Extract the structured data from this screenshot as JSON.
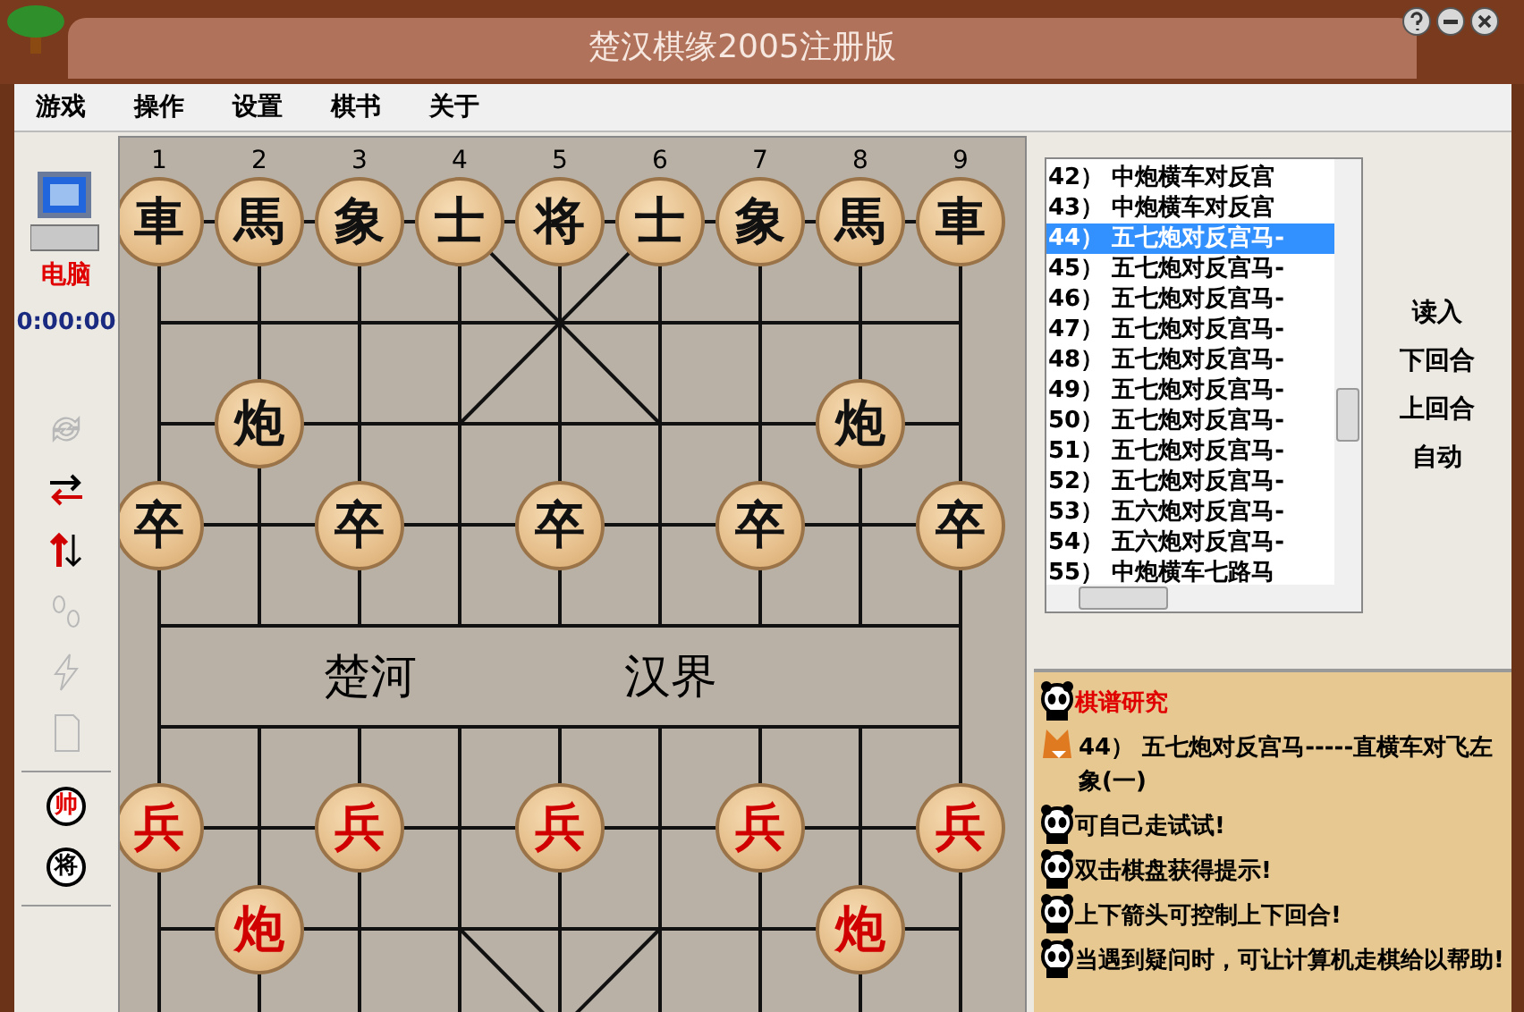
{
  "window": {
    "title": "楚汉棋缘2005注册版"
  },
  "menu": [
    {
      "label": "游戏"
    },
    {
      "label": "操作"
    },
    {
      "label": "设置"
    },
    {
      "label": "棋书"
    },
    {
      "label": "关于"
    }
  ],
  "player": {
    "name": "电脑",
    "time": "0:00:00"
  },
  "toolbar": [
    {
      "kind": "cycle",
      "disabled": true
    },
    {
      "kind": "swap",
      "disabled": false
    },
    {
      "kind": "updown",
      "disabled": false
    },
    {
      "kind": "steps",
      "disabled": true
    },
    {
      "kind": "bolt",
      "disabled": true
    },
    {
      "kind": "page",
      "disabled": true
    }
  ],
  "side_buttons": [
    {
      "label": "帅",
      "color": "#e00000"
    },
    {
      "label": "将",
      "color": "#000000"
    }
  ],
  "board": {
    "file_numbers": [
      "1",
      "2",
      "3",
      "4",
      "5",
      "6",
      "7",
      "8",
      "9"
    ],
    "river": [
      "楚河",
      "汉界"
    ],
    "ranks": [
      {
        "cells": [
          {
            "label": "車",
            "red": false
          },
          {
            "label": "馬",
            "red": false
          },
          {
            "label": "象",
            "red": false
          },
          {
            "label": "士",
            "red": false
          },
          {
            "label": "将",
            "red": false
          },
          {
            "label": "士",
            "red": false
          },
          {
            "label": "象",
            "red": false
          },
          {
            "label": "馬",
            "red": false
          },
          {
            "label": "車",
            "red": false
          }
        ]
      },
      {
        "cells": [
          null,
          null,
          null,
          null,
          null,
          null,
          null,
          null,
          null
        ]
      },
      {
        "cells": [
          null,
          {
            "label": "炮",
            "red": false
          },
          null,
          null,
          null,
          null,
          null,
          {
            "label": "炮",
            "red": false
          },
          null
        ]
      },
      {
        "cells": [
          {
            "label": "卒",
            "red": false
          },
          null,
          {
            "label": "卒",
            "red": false
          },
          null,
          {
            "label": "卒",
            "red": false
          },
          null,
          {
            "label": "卒",
            "red": false
          },
          null,
          {
            "label": "卒",
            "red": false
          }
        ]
      },
      {
        "cells": [
          null,
          null,
          null,
          null,
          null,
          null,
          null,
          null,
          null
        ]
      },
      {
        "cells": [
          null,
          null,
          null,
          null,
          null,
          null,
          null,
          null,
          null
        ]
      },
      {
        "cells": [
          {
            "label": "兵",
            "red": true
          },
          null,
          {
            "label": "兵",
            "red": true
          },
          null,
          {
            "label": "兵",
            "red": true
          },
          null,
          {
            "label": "兵",
            "red": true
          },
          null,
          {
            "label": "兵",
            "red": true
          }
        ]
      },
      {
        "cells": [
          null,
          {
            "label": "炮",
            "red": true
          },
          null,
          null,
          null,
          null,
          null,
          {
            "label": "炮",
            "red": true
          },
          null
        ]
      }
    ]
  },
  "game_list": {
    "items": [
      {
        "label": "42） 中炮横车对反宫",
        "selected": false
      },
      {
        "label": "43） 中炮横车对反宫",
        "selected": false
      },
      {
        "label": "44） 五七炮对反宫马-",
        "selected": true
      },
      {
        "label": "45） 五七炮对反宫马-",
        "selected": false
      },
      {
        "label": "46） 五七炮对反宫马-",
        "selected": false
      },
      {
        "label": "47） 五七炮对反宫马-",
        "selected": false
      },
      {
        "label": "48） 五七炮对反宫马-",
        "selected": false
      },
      {
        "label": "49） 五七炮对反宫马-",
        "selected": false
      },
      {
        "label": "50） 五七炮对反宫马-",
        "selected": false
      },
      {
        "label": "51） 五七炮对反宫马-",
        "selected": false
      },
      {
        "label": "52） 五七炮对反宫马-",
        "selected": false
      },
      {
        "label": "53） 五六炮对反宫马-",
        "selected": false
      },
      {
        "label": "54） 五六炮对反宫马-",
        "selected": false
      },
      {
        "label": "55） 中炮横车七路马",
        "selected": false
      }
    ]
  },
  "buttons": [
    {
      "label": "读入"
    },
    {
      "label": "下回合"
    },
    {
      "label": "上回合"
    },
    {
      "label": "自动"
    }
  ],
  "messages": [
    {
      "kind": "heading",
      "text": "棋谱研究"
    },
    {
      "kind": "fox",
      "text": "44） 五七炮对反宫马-----直横车对飞左象(一)"
    },
    {
      "kind": "panda",
      "text": "可自己走试试!"
    },
    {
      "kind": "panda",
      "text": "双击棋盘获得提示!"
    },
    {
      "kind": "panda",
      "text": "上下箭头可控制上下回合!"
    },
    {
      "kind": "panda",
      "text": "当遇到疑问时，可让计算机走棋给以帮助!"
    }
  ]
}
